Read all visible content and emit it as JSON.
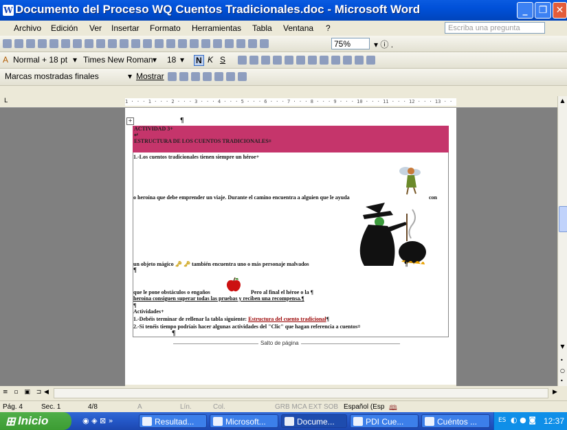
{
  "window": {
    "title": "Documento del Proceso WQ Cuentos Tradicionales.doc - Microsoft Word"
  },
  "menu": {
    "items": [
      "Archivo",
      "Edición",
      "Ver",
      "Insertar",
      "Formato",
      "Herramientas",
      "Tabla",
      "Ventana",
      "?"
    ],
    "ask_placeholder": "Escriba una pregunta"
  },
  "toolbar_standard": {
    "zoom": "75%"
  },
  "toolbar_format": {
    "style": "Normal + 18 pt",
    "font": "Times New Roman",
    "size": "18"
  },
  "toolbar_review": {
    "markup": "Marcas mostradas finales",
    "show": "Mostrar"
  },
  "ruler": {
    "ticks": "1 · · · 1 · · · 2 · · · 3 · · · 4 · · · 5 · · · 6 · · · 7 · · · 8 · · · 9 · · · 10 · · · 11 · · · 12 · · · 13 · · · 14 · · · 15 · · · 16 · · · 17 · · · 18 · · · 19 ·"
  },
  "document": {
    "header_line1": "ACTIVIDAD 3+",
    "header_line2": "↵",
    "header_line3": "ESTRUCTURA DE LOS CUENTOS TRADICIONALES¤",
    "p1": "1.-Los cuentos tradicionales tienen siempre un héroe+",
    "p2": "o heroína que debe emprender un viaje. Durante el camino encuentra a alguien que le ayuda",
    "p2_end": "con",
    "p3": "un objeto mágico",
    "p3b": "también encuentra uno o más personaje malvados",
    "p4": "que le pone obstáculos o engaños",
    "p4b": "Pero al final el héroe o la ¶",
    "p5": "heroína consiguen superar todas las pruebas y reciben una recompensa.¶",
    "p6": "Actividades+",
    "p7_pre": "1.-Debéis terminar de rellenar la tabla siguiente: ",
    "p7_link": "Estructura del cuento tradicional",
    "p8": "2.-Si tenéis tiempo podríais hacer algunas actividades del \"Clic\" que hagan referencia a cuentos¤",
    "page_break": "Salto de página",
    "pilcrow": "¶"
  },
  "status": {
    "page": "Pág. 4",
    "section": "Sec. 1",
    "pages": "4/8",
    "at": "A",
    "line": "Lín.",
    "col": "Col.",
    "modes": "GRB  MCA  EXT  SOB",
    "language": "Español (Esp"
  },
  "taskbar": {
    "start": "Inicio",
    "tasks": [
      "Resultad...",
      "Microsoft...",
      "Docume...",
      "PDI Cue...",
      "Cuéntos ..."
    ],
    "clock": "12:37",
    "lang": "ES"
  }
}
